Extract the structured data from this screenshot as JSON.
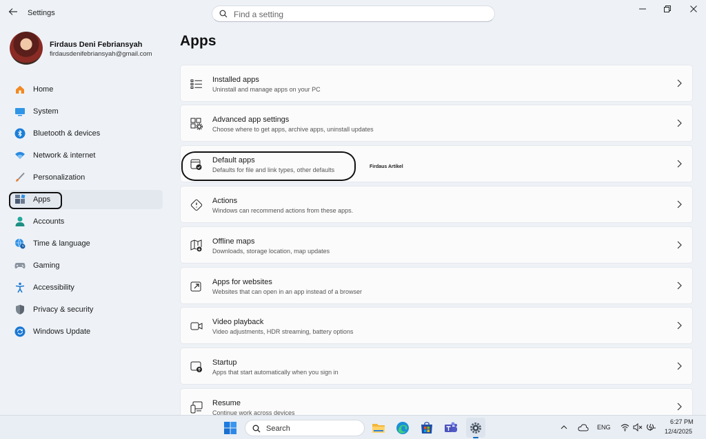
{
  "window": {
    "app_title": "Settings",
    "search_placeholder": "Find a setting"
  },
  "profile": {
    "name": "Firdaus Deni Febriansyah",
    "email": "firdausdenifebriansyah@gmail.com"
  },
  "sidebar": {
    "items": [
      {
        "label": "Home",
        "icon": "home-icon"
      },
      {
        "label": "System",
        "icon": "system-icon"
      },
      {
        "label": "Bluetooth & devices",
        "icon": "bluetooth-icon"
      },
      {
        "label": "Network & internet",
        "icon": "wifi-icon"
      },
      {
        "label": "Personalization",
        "icon": "brush-icon"
      },
      {
        "label": "Apps",
        "icon": "apps-icon",
        "selected": true
      },
      {
        "label": "Accounts",
        "icon": "person-icon"
      },
      {
        "label": "Time & language",
        "icon": "globe-clock-icon"
      },
      {
        "label": "Gaming",
        "icon": "gamepad-icon"
      },
      {
        "label": "Accessibility",
        "icon": "accessibility-icon"
      },
      {
        "label": "Privacy & security",
        "icon": "shield-icon"
      },
      {
        "label": "Windows Update",
        "icon": "update-icon"
      }
    ]
  },
  "main": {
    "title": "Apps",
    "cards": [
      {
        "title": "Installed apps",
        "desc": "Uninstall and manage apps on your PC",
        "icon": "list-icon"
      },
      {
        "title": "Advanced app settings",
        "desc": "Choose where to get apps, archive apps, uninstall updates",
        "icon": "app-settings-icon"
      },
      {
        "title": "Default apps",
        "desc": "Defaults for file and link types, other defaults",
        "icon": "default-apps-icon"
      },
      {
        "title": "Actions",
        "desc": "Windows can recommend actions from these apps.",
        "icon": "actions-icon"
      },
      {
        "title": "Offline maps",
        "desc": "Downloads, storage location, map updates",
        "icon": "map-icon"
      },
      {
        "title": "Apps for websites",
        "desc": "Websites that can open in an app instead of a browser",
        "icon": "open-link-icon"
      },
      {
        "title": "Video playback",
        "desc": "Video adjustments, HDR streaming, battery options",
        "icon": "video-icon"
      },
      {
        "title": "Startup",
        "desc": "Apps that start automatically when you sign in",
        "icon": "startup-icon"
      },
      {
        "title": "Resume",
        "desc": "Continue work across devices",
        "icon": "resume-icon"
      }
    ],
    "watermark": "Firdaus Artikel"
  },
  "taskbar": {
    "search_label": "Search",
    "language": "ENG",
    "time": "6:27 PM",
    "date": "12/4/2025"
  },
  "colors": {
    "accent": "#0067c0",
    "background": "#eef2f7",
    "card": "#fbfbfc"
  }
}
